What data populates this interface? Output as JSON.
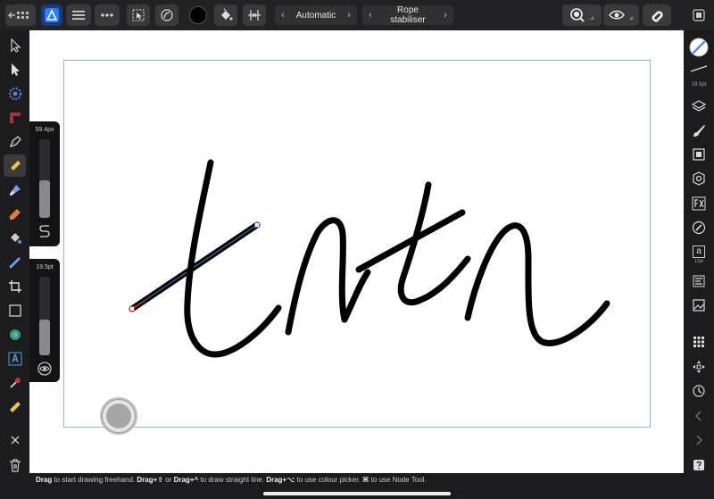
{
  "toolbar": {
    "mode_label": "Automatic",
    "stabiliser_label": "Rope stabiliser",
    "fill_color": "#000000"
  },
  "sliders": {
    "width_value": "59.4px",
    "width_level": 0.48,
    "size_value": "19.5pt",
    "size_level": 0.46
  },
  "studio": {
    "brush_size": "19.5pt",
    "text_style_label": "a",
    "text_style_size": "12pt"
  },
  "status": {
    "drag1": "Drag",
    "text1": " to start drawing freehand. ",
    "drag2": "Drag+⇧",
    "text2": " or ",
    "drag3": "Drag+^",
    "text3": " to draw straight line. ",
    "drag4": "Drag+⌥",
    "text4": " to use colour picker. ",
    "key5": "⌘",
    "text5": " to use Node Tool."
  },
  "icons": {
    "accent": "#2d7ff9",
    "tool_red": "#c0392b"
  }
}
